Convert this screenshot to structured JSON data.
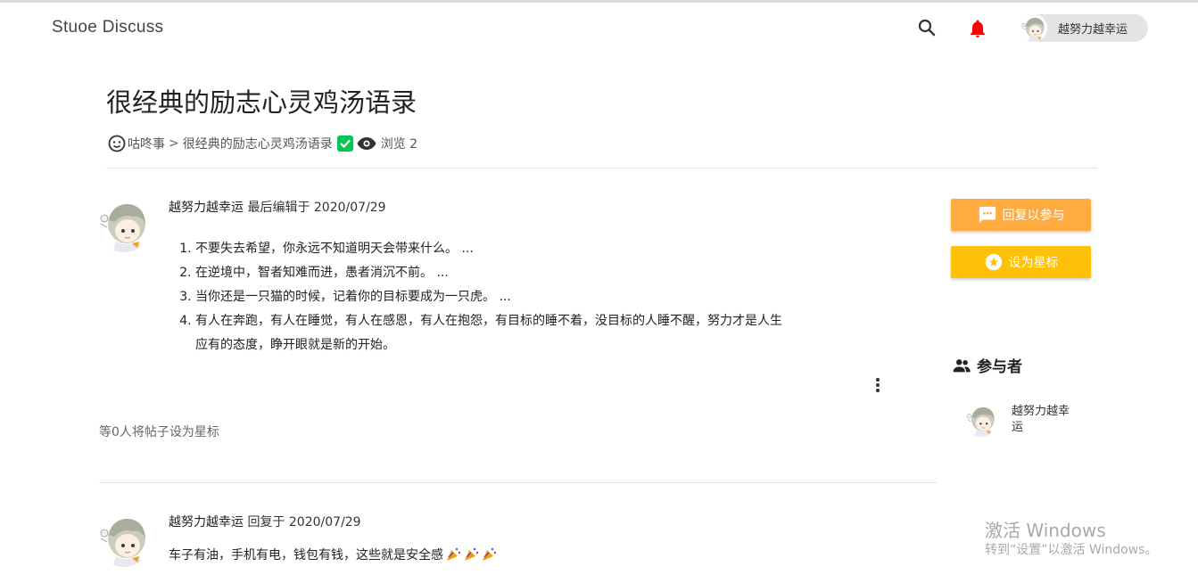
{
  "header": {
    "brand": "Stuoe Discuss",
    "user_name": "越努力越幸运"
  },
  "post": {
    "title": "很经典的励志心灵鸡汤语录",
    "breadcrumb_category": "咕咚事",
    "breadcrumb_separator": ">",
    "breadcrumb_current": "很经典的励志心灵鸡汤语录",
    "views_text": "浏览 2",
    "author": "越努力越幸运",
    "edit_label": "最后编辑于 2020/07/29",
    "items": [
      "不要失去希望，你永远不知道明天会带来什么。 ...",
      "在逆境中，智者知难而进，愚者消沉不前。 ...",
      "当你还是一只猫的时候，记着你的目标要成为一只虎。 ...",
      "有人在奔跑，有人在睡觉，有人在感恩，有人在抱怨，有目标的睡不着，没目标的人睡不醒，努力才是人生应有的态度，睁开眼就是新的开始。"
    ],
    "star_count_text": "等0人将帖子设为星标"
  },
  "reply": {
    "author": "越努力越幸运",
    "reply_label": "回复于 2020/07/29",
    "text": "车子有油，手机有电，钱包有钱，这些就是安全感"
  },
  "sidebar": {
    "reply_button": "回复以参与",
    "star_button": "设为星标",
    "participants_title": "参与者",
    "participants": [
      {
        "name": "越努力越幸运"
      }
    ]
  },
  "watermark": {
    "title": "激活 Windows",
    "subtitle": "转到“设置”以激活 Windows。"
  },
  "colors": {
    "reply_button": "#ffab40",
    "star_button": "#ffc107",
    "bell": "#ff0000",
    "check": "#00c853"
  }
}
